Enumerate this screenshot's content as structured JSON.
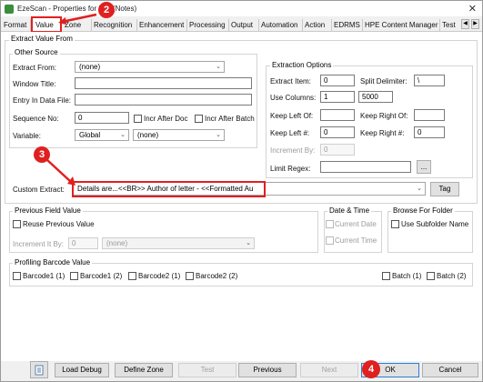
{
  "window": {
    "title": "EzeScan - Properties for Fi... (Notes)",
    "close_symbol": "✕"
  },
  "tabs": [
    "Format",
    "Value",
    "Zone",
    "Recognition",
    "Enhancement",
    "Processing",
    "Output",
    "Automation",
    "Action",
    "EDRMS",
    "HPE Content Manager",
    "Test"
  ],
  "active_tab": "Value",
  "tab_scroll": {
    "left": "◀",
    "right": "▶"
  },
  "extract_value_from": {
    "title": "Extract Value From",
    "other_source": {
      "title": "Other Source",
      "extract_from_label": "Extract From:",
      "extract_from_value": "(none)",
      "window_title_label": "Window Title:",
      "window_title_value": "",
      "entry_in_data_file_label": "Entry In Data File:",
      "entry_in_data_file_value": "",
      "sequence_no_label": "Sequence No:",
      "sequence_no_value": "0",
      "incr_after_doc_label": "Incr After Doc",
      "incr_after_batch_label": "Incr After Batch",
      "variable_label": "Variable:",
      "variable_scope": "Global",
      "variable_value": "(none)"
    },
    "extraction_options": {
      "title": "Extraction Options",
      "extract_item_label": "Extract Item:",
      "extract_item_value": "0",
      "split_delimiter_label": "Split Delimiter:",
      "split_delimiter_value": "\\",
      "use_columns_label": "Use Columns:",
      "use_columns_start": "1",
      "use_columns_end": "5000",
      "keep_left_of_label": "Keep Left Of:",
      "keep_left_of_value": "",
      "keep_right_of_label": "Keep Right Of:",
      "keep_right_of_value": "",
      "keep_left_num_label": "Keep Left #:",
      "keep_left_num_value": "0",
      "keep_right_num_label": "Keep Right #:",
      "keep_right_num_value": "0",
      "increment_by_label": "Increment By:",
      "increment_by_value": "0",
      "limit_regex_label": "Limit Regex:",
      "limit_regex_value": "",
      "limit_regex_button": "..."
    },
    "custom_extract_label": "Custom Extract:",
    "custom_extract_value": "Details are...<<BR>>    Author of letter - <<Formatted Au",
    "tag_button": "Tag"
  },
  "previous_field_value": {
    "title": "Previous Field Value",
    "reuse_label": "Reuse Previous Value",
    "increment_it_by_label": "Increment It By:",
    "increment_it_by_value": "0",
    "increment_select": "(none)"
  },
  "date_time": {
    "title": "Date & Time",
    "current_date_label": "Current Date",
    "current_time_label": "Current Time"
  },
  "browse_for_folder": {
    "title": "Browse For Folder",
    "use_subfolder_label": "Use Subfolder Name"
  },
  "profiling_barcode": {
    "title": "Profiling Barcode Value",
    "items": [
      "Barcode1 (1)",
      "Barcode1 (2)",
      "Barcode2 (1)",
      "Barcode2 (2)",
      "Batch (1)",
      "Batch (2)"
    ]
  },
  "bottom_buttons": {
    "load_debug": "Load Debug",
    "define_zone": "Define Zone",
    "test": "Test",
    "previous": "Previous",
    "next": "Next",
    "ok": "OK",
    "cancel": "Cancel"
  },
  "markers": [
    "2",
    "3",
    "4"
  ],
  "colors": {
    "annotation": "#e02020",
    "focus": "#2a7fd6"
  }
}
